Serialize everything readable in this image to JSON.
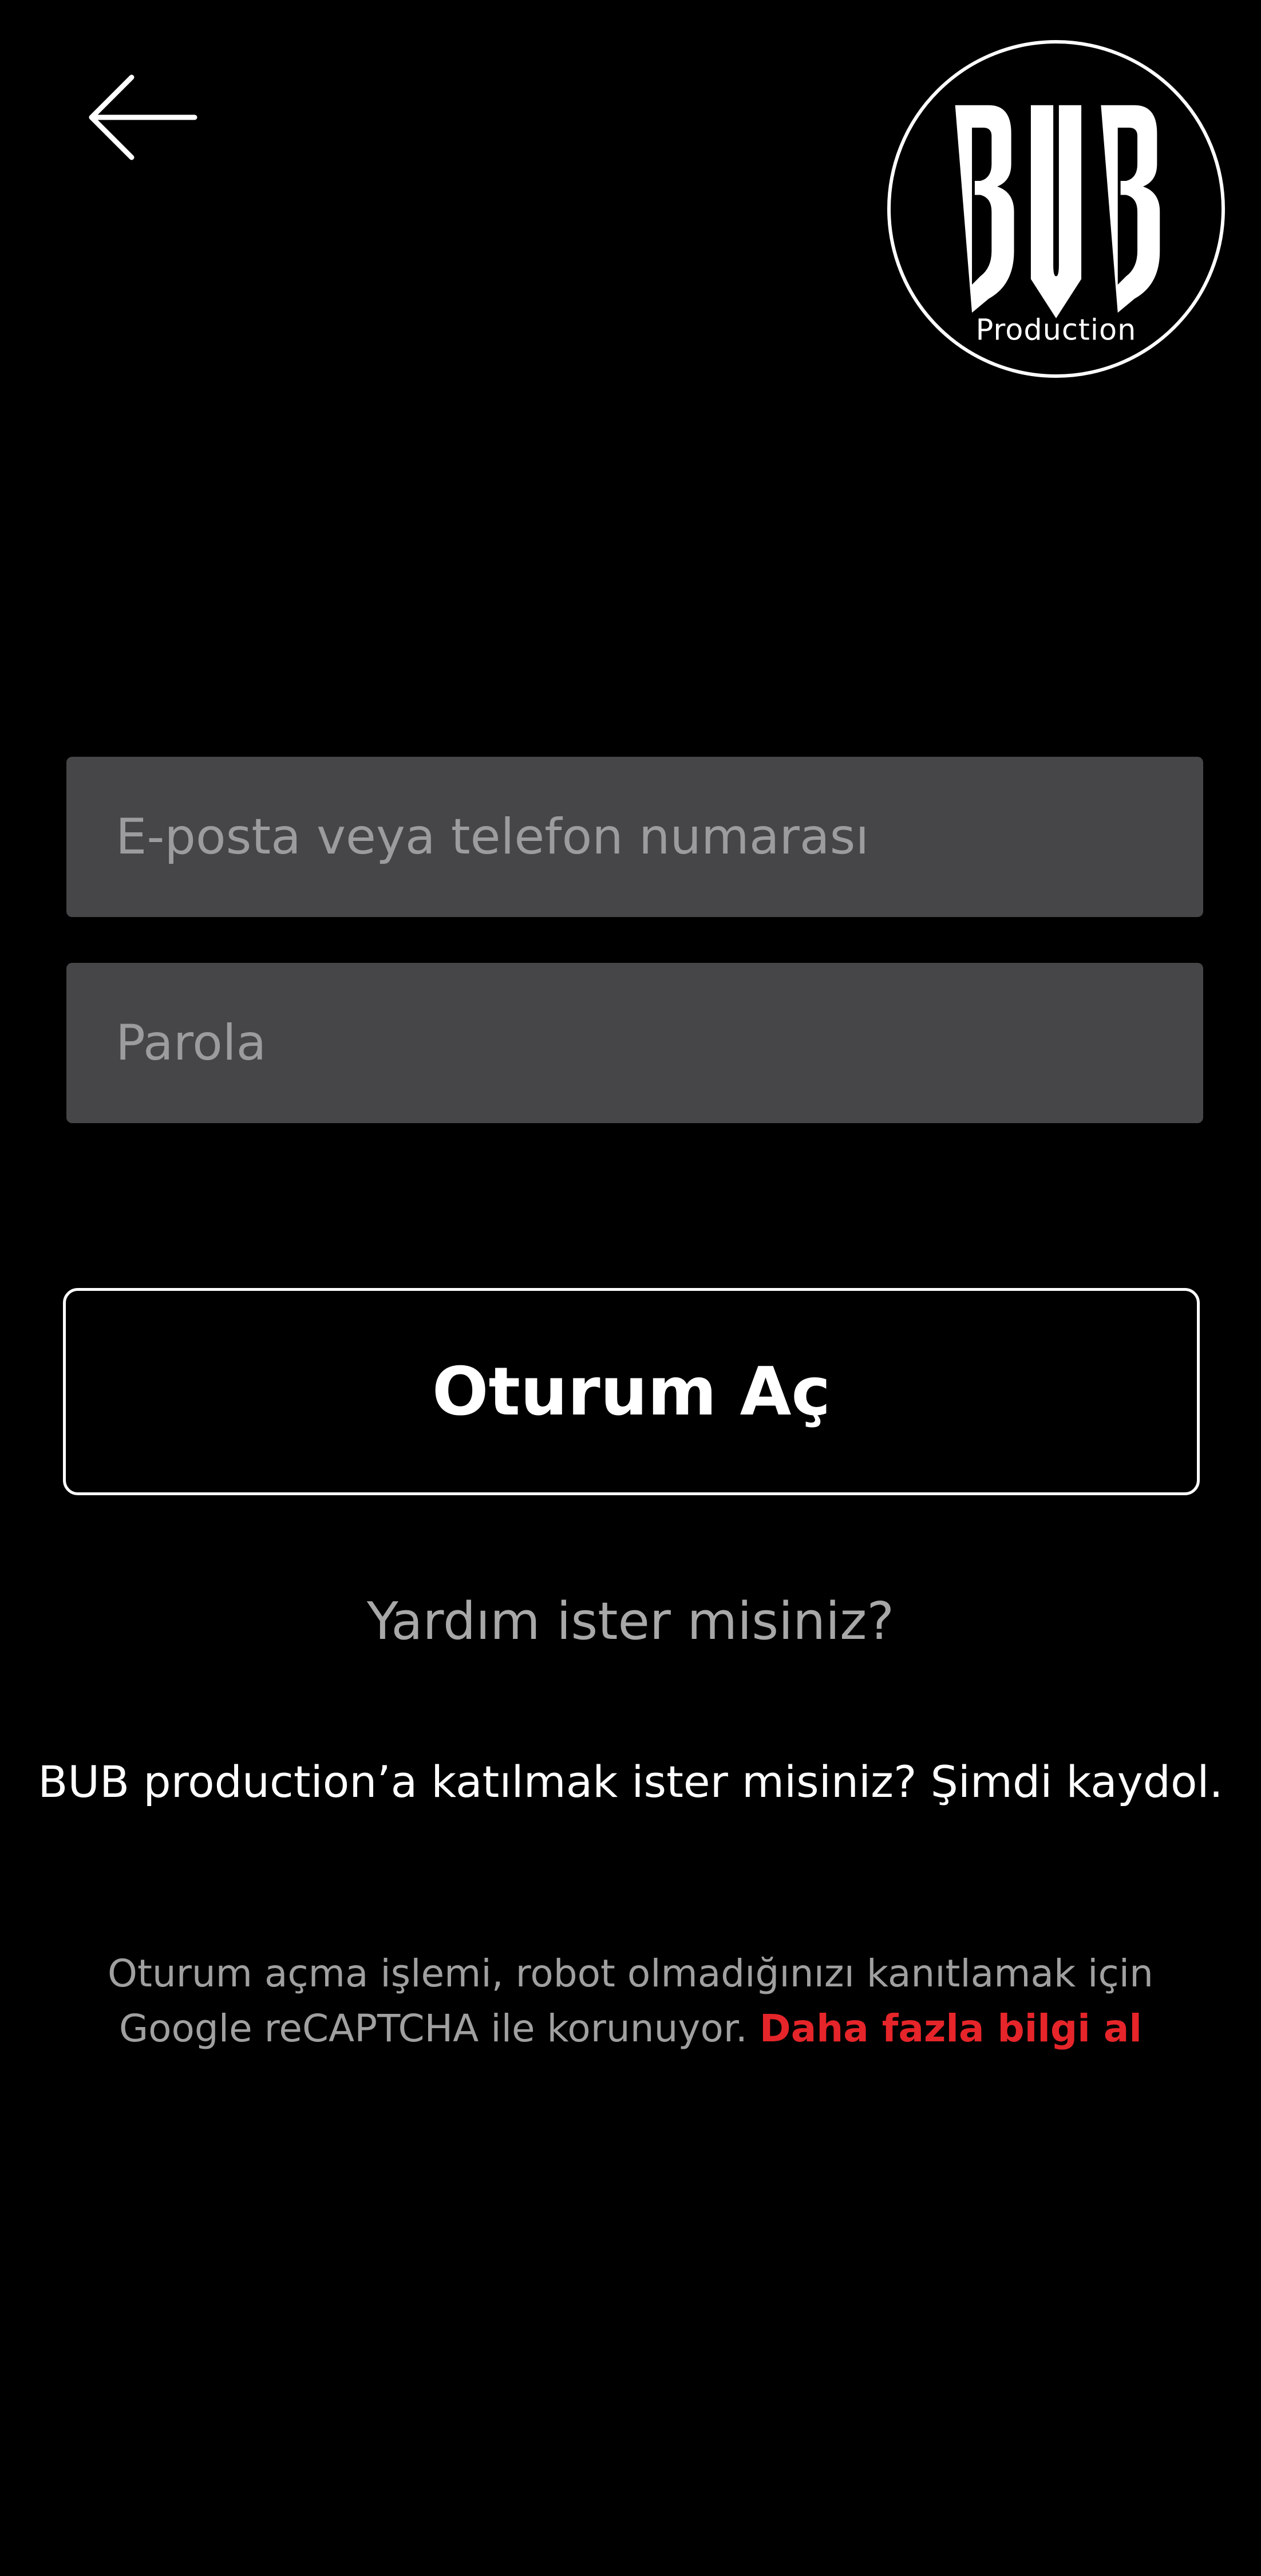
{
  "header": {
    "back_icon": "arrow-left-icon",
    "logo": {
      "text": "BUB",
      "subtext": "Production"
    }
  },
  "form": {
    "email_placeholder": "E-posta veya telefon numarası",
    "email_value": "",
    "password_placeholder": "Parola",
    "password_value": "",
    "signin_label": "Oturum Aç"
  },
  "help_label": "Yardım ister misiniz?",
  "signup_text": "BUB production’a katılmak ister misiniz? Şimdi kaydol.",
  "recaptcha": {
    "line1": "Oturum açma işlemi, robot olmadığınızı kanıtlamak için",
    "line2": "Google reCAPTCHA ile korunuyor.",
    "learn_more": "Daha fazla bilgi al"
  },
  "colors": {
    "background": "#000000",
    "field_background": "#464648",
    "accent_red": "#e5252a",
    "muted_text": "#a0a0a0"
  }
}
